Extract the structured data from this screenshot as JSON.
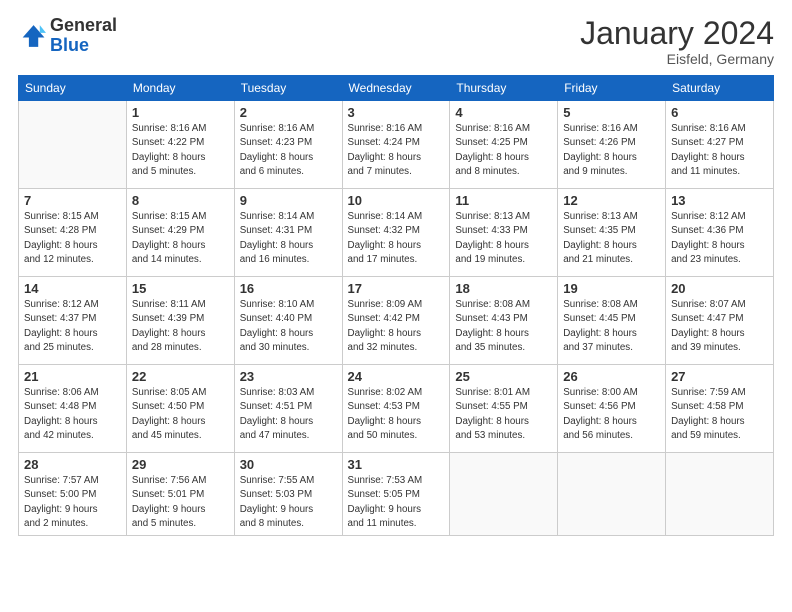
{
  "header": {
    "logo_general": "General",
    "logo_blue": "Blue",
    "month_title": "January 2024",
    "location": "Eisfeld, Germany"
  },
  "weekdays": [
    "Sunday",
    "Monday",
    "Tuesday",
    "Wednesday",
    "Thursday",
    "Friday",
    "Saturday"
  ],
  "weeks": [
    [
      {
        "day": "",
        "empty": true
      },
      {
        "day": "1",
        "sunrise": "8:16 AM",
        "sunset": "4:22 PM",
        "daylight": "8 hours and 5 minutes."
      },
      {
        "day": "2",
        "sunrise": "8:16 AM",
        "sunset": "4:23 PM",
        "daylight": "8 hours and 6 minutes."
      },
      {
        "day": "3",
        "sunrise": "8:16 AM",
        "sunset": "4:24 PM",
        "daylight": "8 hours and 7 minutes."
      },
      {
        "day": "4",
        "sunrise": "8:16 AM",
        "sunset": "4:25 PM",
        "daylight": "8 hours and 8 minutes."
      },
      {
        "day": "5",
        "sunrise": "8:16 AM",
        "sunset": "4:26 PM",
        "daylight": "8 hours and 9 minutes."
      },
      {
        "day": "6",
        "sunrise": "8:16 AM",
        "sunset": "4:27 PM",
        "daylight": "8 hours and 11 minutes."
      }
    ],
    [
      {
        "day": "7",
        "sunrise": "8:15 AM",
        "sunset": "4:28 PM",
        "daylight": "8 hours and 12 minutes."
      },
      {
        "day": "8",
        "sunrise": "8:15 AM",
        "sunset": "4:29 PM",
        "daylight": "8 hours and 14 minutes."
      },
      {
        "day": "9",
        "sunrise": "8:14 AM",
        "sunset": "4:31 PM",
        "daylight": "8 hours and 16 minutes."
      },
      {
        "day": "10",
        "sunrise": "8:14 AM",
        "sunset": "4:32 PM",
        "daylight": "8 hours and 17 minutes."
      },
      {
        "day": "11",
        "sunrise": "8:13 AM",
        "sunset": "4:33 PM",
        "daylight": "8 hours and 19 minutes."
      },
      {
        "day": "12",
        "sunrise": "8:13 AM",
        "sunset": "4:35 PM",
        "daylight": "8 hours and 21 minutes."
      },
      {
        "day": "13",
        "sunrise": "8:12 AM",
        "sunset": "4:36 PM",
        "daylight": "8 hours and 23 minutes."
      }
    ],
    [
      {
        "day": "14",
        "sunrise": "8:12 AM",
        "sunset": "4:37 PM",
        "daylight": "8 hours and 25 minutes."
      },
      {
        "day": "15",
        "sunrise": "8:11 AM",
        "sunset": "4:39 PM",
        "daylight": "8 hours and 28 minutes."
      },
      {
        "day": "16",
        "sunrise": "8:10 AM",
        "sunset": "4:40 PM",
        "daylight": "8 hours and 30 minutes."
      },
      {
        "day": "17",
        "sunrise": "8:09 AM",
        "sunset": "4:42 PM",
        "daylight": "8 hours and 32 minutes."
      },
      {
        "day": "18",
        "sunrise": "8:08 AM",
        "sunset": "4:43 PM",
        "daylight": "8 hours and 35 minutes."
      },
      {
        "day": "19",
        "sunrise": "8:08 AM",
        "sunset": "4:45 PM",
        "daylight": "8 hours and 37 minutes."
      },
      {
        "day": "20",
        "sunrise": "8:07 AM",
        "sunset": "4:47 PM",
        "daylight": "8 hours and 39 minutes."
      }
    ],
    [
      {
        "day": "21",
        "sunrise": "8:06 AM",
        "sunset": "4:48 PM",
        "daylight": "8 hours and 42 minutes."
      },
      {
        "day": "22",
        "sunrise": "8:05 AM",
        "sunset": "4:50 PM",
        "daylight": "8 hours and 45 minutes."
      },
      {
        "day": "23",
        "sunrise": "8:03 AM",
        "sunset": "4:51 PM",
        "daylight": "8 hours and 47 minutes."
      },
      {
        "day": "24",
        "sunrise": "8:02 AM",
        "sunset": "4:53 PM",
        "daylight": "8 hours and 50 minutes."
      },
      {
        "day": "25",
        "sunrise": "8:01 AM",
        "sunset": "4:55 PM",
        "daylight": "8 hours and 53 minutes."
      },
      {
        "day": "26",
        "sunrise": "8:00 AM",
        "sunset": "4:56 PM",
        "daylight": "8 hours and 56 minutes."
      },
      {
        "day": "27",
        "sunrise": "7:59 AM",
        "sunset": "4:58 PM",
        "daylight": "8 hours and 59 minutes."
      }
    ],
    [
      {
        "day": "28",
        "sunrise": "7:57 AM",
        "sunset": "5:00 PM",
        "daylight": "9 hours and 2 minutes."
      },
      {
        "day": "29",
        "sunrise": "7:56 AM",
        "sunset": "5:01 PM",
        "daylight": "9 hours and 5 minutes."
      },
      {
        "day": "30",
        "sunrise": "7:55 AM",
        "sunset": "5:03 PM",
        "daylight": "9 hours and 8 minutes."
      },
      {
        "day": "31",
        "sunrise": "7:53 AM",
        "sunset": "5:05 PM",
        "daylight": "9 hours and 11 minutes."
      },
      {
        "day": "",
        "empty": true
      },
      {
        "day": "",
        "empty": true
      },
      {
        "day": "",
        "empty": true
      }
    ]
  ]
}
